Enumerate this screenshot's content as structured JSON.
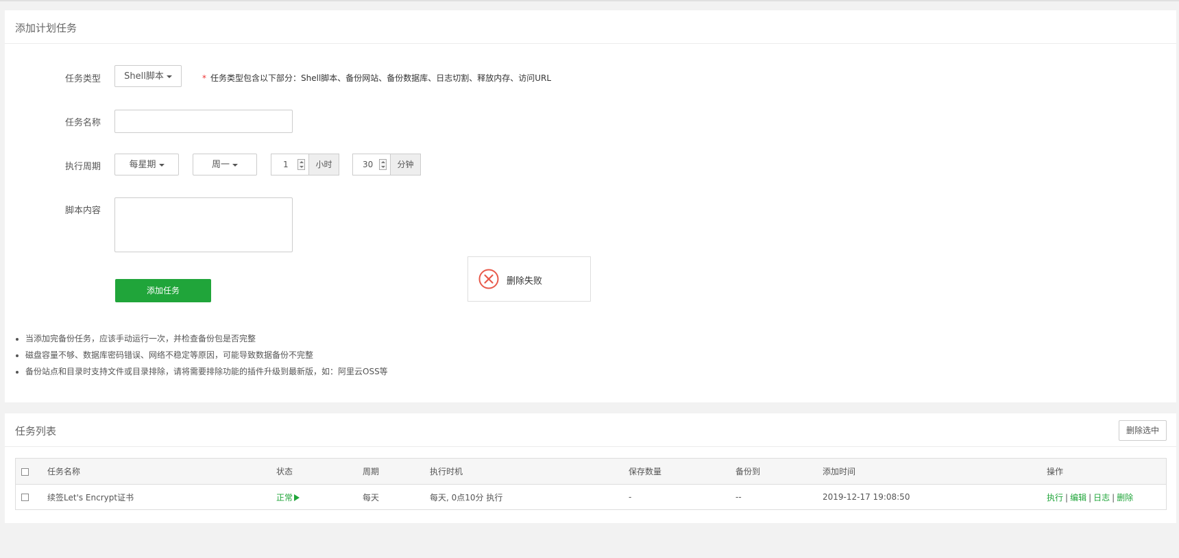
{
  "add_panel": {
    "title": "添加计划任务",
    "task_type_label": "任务类型",
    "task_type_value": "Shell脚本",
    "task_type_hint": "任务类型包含以下部分：Shell脚本、备份网站、备份数据库、日志切割、释放内存、访问URL",
    "hint_star": "*",
    "task_name_label": "任务名称",
    "task_name_value": "",
    "cycle_label": "执行周期",
    "cycle_type": "每星期",
    "cycle_weekday": "周一",
    "hour_value": "1",
    "hour_unit": "小时",
    "minute_value": "30",
    "minute_unit": "分钟",
    "script_label": "脚本内容",
    "script_value": "",
    "add_button": "添加任务",
    "notes": [
      "当添加完备份任务，应该手动运行一次，并检查备份包是否完整",
      "磁盘容量不够、数据库密码错误、网络不稳定等原因，可能导致数据备份不完整",
      "备份站点和目录时支持文件或目录排除，请将需要排除功能的插件升级到最新版，如：阿里云OSS等"
    ]
  },
  "toast": {
    "message": "删除失败",
    "icon": "error-x-icon",
    "color": "#e8594a"
  },
  "list_panel": {
    "title": "任务列表",
    "delete_selected": "删除选中",
    "columns": [
      "任务名称",
      "状态",
      "周期",
      "执行时机",
      "保存数量",
      "备份到",
      "添加时间",
      "操作"
    ],
    "rows": [
      {
        "name": "续签Let's Encrypt证书",
        "status": "正常",
        "cycle": "每天",
        "timing": "每天, 0点10分 执行",
        "keep": "-",
        "backup_to": "--",
        "added": "2019-12-17 19:08:50",
        "actions": [
          "执行",
          "编辑",
          "日志",
          "删除"
        ]
      }
    ]
  },
  "colors": {
    "accent": "#20a53a",
    "error": "#e8594a"
  }
}
